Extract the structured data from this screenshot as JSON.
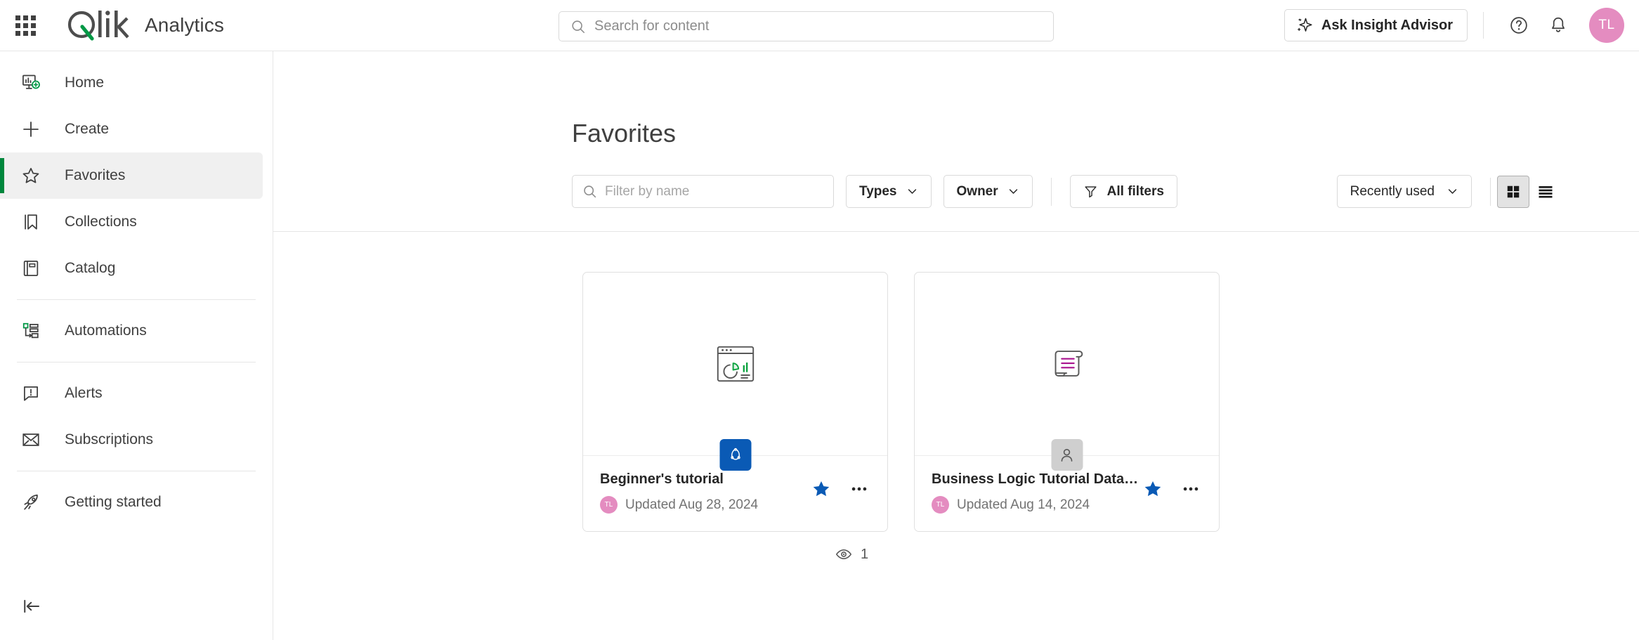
{
  "header": {
    "apps_grid_icon": "apps-grid-icon",
    "logo_text": "Qlik",
    "app_name": "Analytics",
    "search": {
      "placeholder": "Search for content",
      "value": "",
      "icon": "search-icon"
    },
    "insight_advisor_label": "Ask Insight Advisor",
    "insight_advisor_icon": "sparkle-icon",
    "help_icon": "help-circle-icon",
    "notifications_icon": "bell-icon",
    "avatar_initials": "TL",
    "avatar_color": "#e48cc0"
  },
  "sidebar": {
    "items": [
      {
        "label": "Home",
        "icon": "home-dashboard-icon",
        "active": false
      },
      {
        "label": "Create",
        "icon": "plus-icon",
        "active": false
      },
      {
        "label": "Favorites",
        "icon": "star-outline-icon",
        "active": true
      },
      {
        "label": "Collections",
        "icon": "bookmark-icon",
        "active": false
      },
      {
        "label": "Catalog",
        "icon": "catalog-book-icon",
        "active": false
      },
      {
        "label": "Automations",
        "icon": "automations-icon",
        "active": false
      },
      {
        "label": "Alerts",
        "icon": "alert-bubble-icon",
        "active": false
      },
      {
        "label": "Subscriptions",
        "icon": "envelope-icon",
        "active": false
      },
      {
        "label": "Getting started",
        "icon": "rocket-icon",
        "active": false
      }
    ],
    "collapse_icon": "collapse-left-icon",
    "active_accent": "#00873d"
  },
  "main": {
    "page_title": "Favorites",
    "filter_input": {
      "placeholder": "Filter by name",
      "value": "",
      "icon": "search-icon"
    },
    "types_label": "Types",
    "owner_label": "Owner",
    "all_filters_label": "All filters",
    "all_filters_icon": "funnel-icon",
    "chevron_icon": "chevron-down-icon",
    "sort_label": "Recently used",
    "grid_view_icon": "grid-view-icon",
    "list_view_icon": "list-view-icon",
    "active_view": "grid",
    "views_icon": "eye-icon",
    "views_count": "1",
    "cards": [
      {
        "title": "Beginner's tutorial",
        "date": "Updated Aug 28, 2024",
        "owner_initials": "TL",
        "owner_color": "#e48cc0",
        "thumb_icon": "app-chart-window-icon",
        "badge_icon": "qlik-app-icon",
        "badge_style": "blue",
        "favorite": true,
        "favorite_icon": "star-filled-icon",
        "menu_icon": "ellipsis-icon"
      },
      {
        "title": "Business Logic Tutorial Data Prep",
        "date": "Updated Aug 14, 2024",
        "owner_initials": "TL",
        "owner_color": "#e48cc0",
        "thumb_icon": "script-scroll-icon",
        "badge_icon": "person-icon",
        "badge_style": "grey",
        "favorite": true,
        "favorite_icon": "star-filled-icon",
        "menu_icon": "ellipsis-icon"
      }
    ]
  },
  "colors": {
    "brand_green": "#009845",
    "star_blue": "#0a5ab5",
    "badge_blue": "#0a5ab5",
    "text_primary": "#404040",
    "text_muted": "#737373",
    "border": "#e6e6e6"
  }
}
